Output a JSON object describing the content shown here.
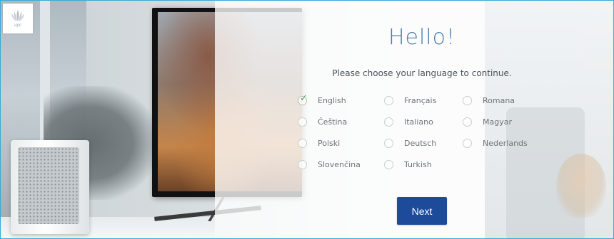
{
  "brand": {
    "logo_text": "upc",
    "logo_icon": "upc-logo-icon"
  },
  "heading": {
    "title": "Hello!",
    "subtitle": "Please choose your language to continue."
  },
  "languages": [
    {
      "label": "English",
      "selected": true
    },
    {
      "label": "Français",
      "selected": false
    },
    {
      "label": "Romana",
      "selected": false
    },
    {
      "label": "Čeština",
      "selected": false
    },
    {
      "label": "Italiano",
      "selected": false
    },
    {
      "label": "Magyar",
      "selected": false
    },
    {
      "label": "Polski",
      "selected": false
    },
    {
      "label": "Deutsch",
      "selected": false
    },
    {
      "label": "Nederlands",
      "selected": false
    },
    {
      "label": "Slovenčina",
      "selected": false
    },
    {
      "label": "Turkish",
      "selected": false
    }
  ],
  "actions": {
    "next_label": "Next"
  },
  "colors": {
    "accent": "#1d4b9a",
    "title": "#4a7fae",
    "check": "#4aa35a",
    "frame_border": "#3aa9d8"
  }
}
